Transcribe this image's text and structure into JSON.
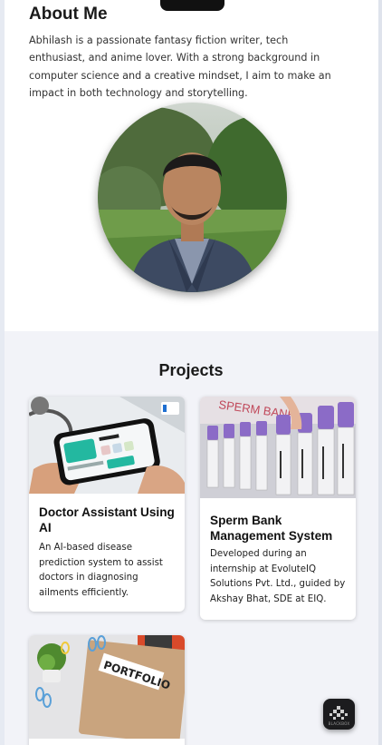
{
  "about": {
    "title": "About Me",
    "text": "Abhilash is a passionate fantasy fiction writer, tech enthusiast, and anime lover. With a strong background in computer science and a creative mindset, I aim to make an impact in both technology and storytelling."
  },
  "projects": {
    "title": "Projects",
    "cards": [
      {
        "title": "Doctor Assistant Using AI",
        "description": "An AI-based disease prediction system to assist doctors in diagnosing ailments efficiently.",
        "image": "doctor-app-phone-photo"
      },
      {
        "title": "Sperm Bank Management System",
        "description": "Developed during an internship at EvoluteIQ Solutions Pvt. Ltd., guided by Akshay Bhat, SDE at EIQ.",
        "image": "sample-tubes-photo",
        "image_text": "SPERM BANK"
      },
      {
        "title": "",
        "description": "",
        "image": "portfolio-folder-photo",
        "image_text": "PORTFOLIO"
      }
    ]
  },
  "fab": {
    "label": "BLACKBOX",
    "icon": "blackbox-icon"
  },
  "colors": {
    "page_bg": "#eef1f6",
    "section_bg": "#f2f3f8",
    "card_bg": "#ffffff",
    "title_color": "#1a1a1a",
    "fab_bg": "#1c1c1e"
  }
}
